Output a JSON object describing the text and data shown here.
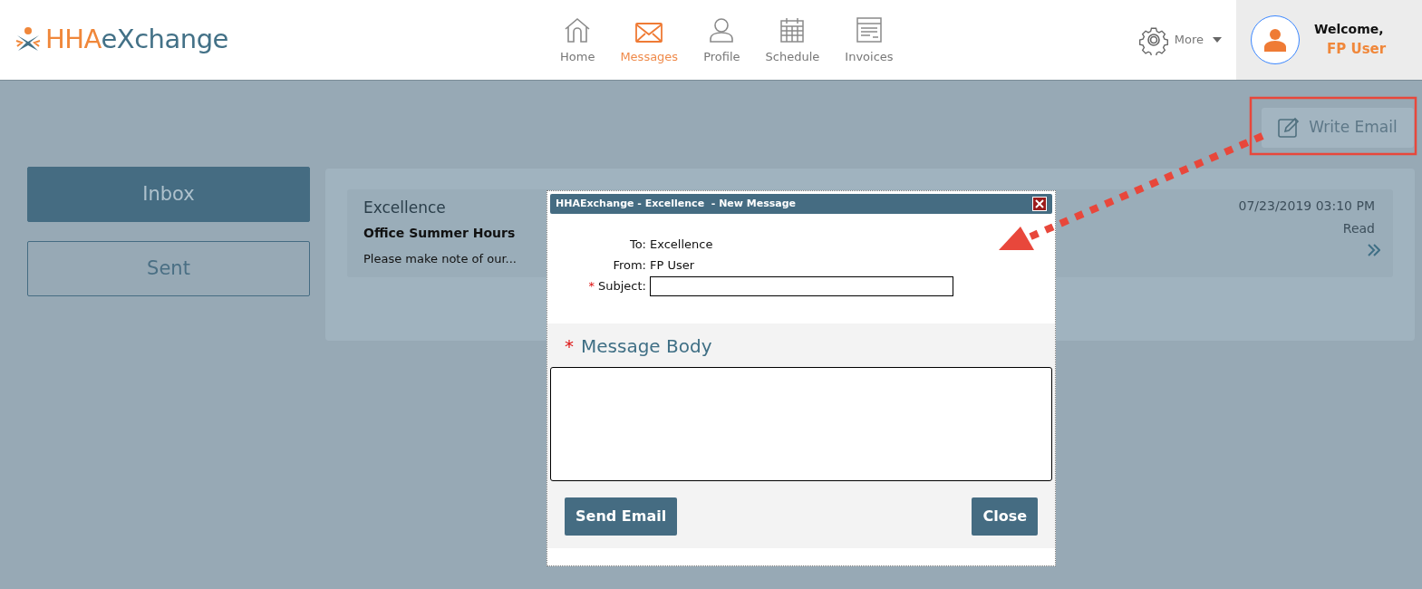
{
  "header": {
    "logo": {
      "segments": [
        {
          "text": "HHA",
          "color": "#f0873a"
        },
        {
          "text": "eXchange",
          "color": "#437187"
        }
      ]
    },
    "nav": [
      {
        "label": "Home",
        "kind": "home",
        "selected": false
      },
      {
        "label": "Messages",
        "kind": "mail",
        "selected": true
      },
      {
        "label": "Profile",
        "kind": "person",
        "selected": false
      },
      {
        "label": "Schedule",
        "kind": "calendar",
        "selected": false
      },
      {
        "label": "Invoices",
        "kind": "invoice",
        "selected": false
      }
    ],
    "more": {
      "label": "More"
    },
    "user": {
      "greeting": "Welcome,",
      "name": "FP User"
    }
  },
  "toolbar": {
    "write_email": "Write Email"
  },
  "folders": [
    {
      "label": "Inbox",
      "selected": true
    },
    {
      "label": "Sent",
      "selected": false
    }
  ],
  "messages": [
    {
      "sender": "Excellence",
      "subject": "Office Summer Hours",
      "preview": "Please make note of our...",
      "date": "07/23/2019 03:10 PM",
      "status": "Read"
    }
  ],
  "dialog": {
    "title": "HHAExchange - Excellence  - New Message",
    "required_mark": "*",
    "fields": [
      {
        "label": "To:",
        "kind": "text",
        "value": "Excellence",
        "required": false
      },
      {
        "label": "From:",
        "kind": "text",
        "value": "FP User",
        "required": false
      },
      {
        "label": "Subject:",
        "kind": "input",
        "required": true
      }
    ],
    "body": {
      "label": "Message Body",
      "required": true
    },
    "buttons": [
      "Send Email",
      "Close"
    ]
  }
}
